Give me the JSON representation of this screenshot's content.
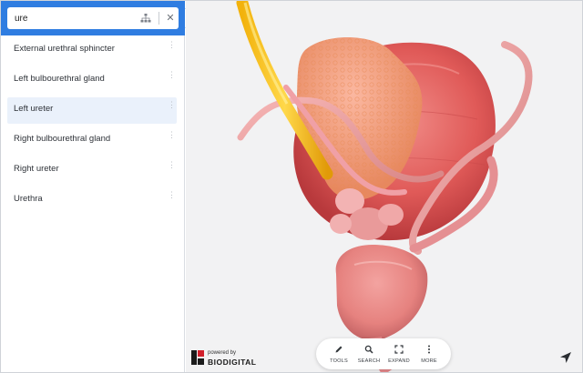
{
  "search": {
    "value": "ure",
    "hierarchy_icon": "hierarchy-icon",
    "clear_icon": "close-icon",
    "clear_glyph": "✕"
  },
  "results": [
    {
      "label": "External urethral sphincter",
      "selected": false
    },
    {
      "label": "Left bulbourethral gland",
      "selected": false
    },
    {
      "label": "Left ureter",
      "selected": true
    },
    {
      "label": "Right bulbourethral gland",
      "selected": false
    },
    {
      "label": "Right ureter",
      "selected": false
    },
    {
      "label": "Urethra",
      "selected": false
    }
  ],
  "menu_glyph": "⋮",
  "collapse_icon": "chevron-left-icon",
  "brand": {
    "powered_by": "powered by",
    "name": "BIODIGITAL"
  },
  "toolbar": {
    "tools": "TOOLS",
    "search": "SEARCH",
    "expand": "EXPAND",
    "more": "MORE"
  },
  "nav_icon": "navigation-arrow-icon",
  "colors": {
    "accent": "#2f7de1",
    "selected_bg": "#eaf1fb",
    "brand_red": "#d11f2b"
  }
}
